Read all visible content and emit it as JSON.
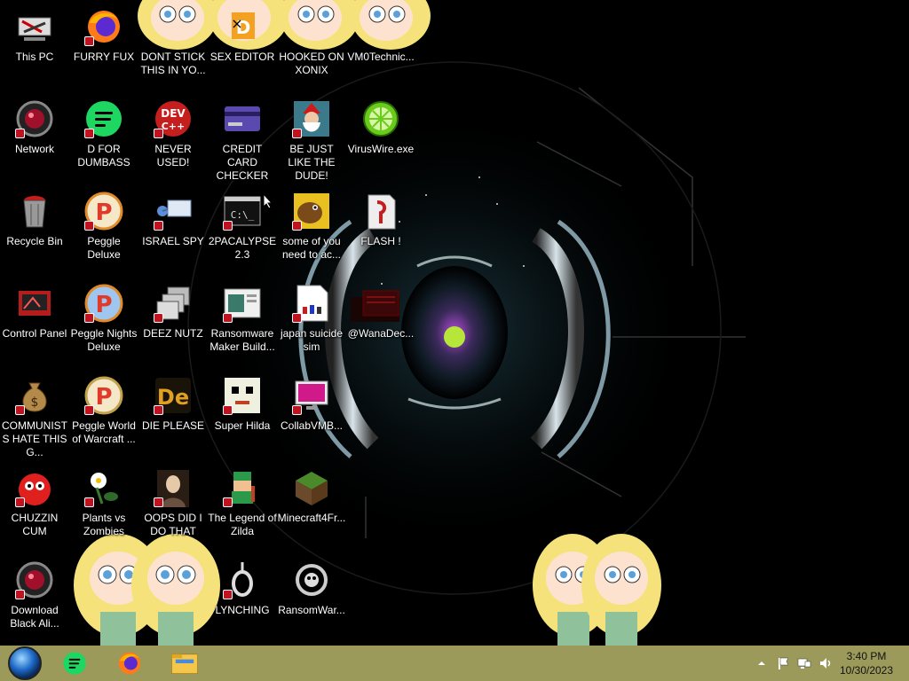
{
  "desktop": {
    "icons": [
      {
        "label": "This PC",
        "icon": "computer-icon"
      },
      {
        "label": "FURRY FUX",
        "icon": "firefox-icon"
      },
      {
        "label": "DONT STICK THIS IN YO...",
        "icon": "cartoon-girl-icon"
      },
      {
        "label": "SEX EDITOR",
        "icon": "editor-icon"
      },
      {
        "label": "HOOKED ON XONIX",
        "icon": "cartoon-girl-icon"
      },
      {
        "label": "VM0Technic...",
        "icon": "cartoon-girl-icon"
      },
      {
        "label": "Network",
        "icon": "network-icon"
      },
      {
        "label": "D FOR DUMBASS",
        "icon": "spotify-icon"
      },
      {
        "label": "NEVER USED!",
        "icon": "devcpp-icon"
      },
      {
        "label": "CREDIT CARD CHECKER",
        "icon": "credit-card-icon"
      },
      {
        "label": "BE JUST LIKE THE DUDE!",
        "icon": "santa-icon"
      },
      {
        "label": "VirusWire.exe",
        "icon": "lime-icon"
      },
      {
        "label": "Recycle Bin",
        "icon": "recycle-bin-icon"
      },
      {
        "label": "Peggle Deluxe",
        "icon": "peggle-icon"
      },
      {
        "label": "ISRAEL SPY",
        "icon": "network-spy-icon"
      },
      {
        "label": "2PACALYPSE 2.3",
        "icon": "terminal-icon"
      },
      {
        "label": "some of you need to ac...",
        "icon": "dog-icon"
      },
      {
        "label": "FLASH !",
        "icon": "flash-icon"
      },
      {
        "label": "Control Panel",
        "icon": "control-panel-icon"
      },
      {
        "label": "Peggle Nights Deluxe",
        "icon": "peggle-icon"
      },
      {
        "label": "DEEZ NUTZ",
        "icon": "stacked-windows-icon"
      },
      {
        "label": "Ransomware Maker Build...",
        "icon": "window-app-icon"
      },
      {
        "label": "japan suicide sim",
        "icon": "document-icon"
      },
      {
        "label": "@WanaDec...",
        "icon": "wannacry-icon"
      },
      {
        "label": "COMMUNISTS HATE THIS G...",
        "icon": "money-bag-icon"
      },
      {
        "label": "Peggle World of Warcraft ...",
        "icon": "peggle-icon"
      },
      {
        "label": "DIE PLEASE",
        "icon": "die-icon"
      },
      {
        "label": "Super Hilda",
        "icon": "pixel-dog-icon"
      },
      {
        "label": "CollabVMB...",
        "icon": "monitor-icon"
      },
      {
        "label": "CHUZZIN CUM",
        "icon": "chuzzle-icon"
      },
      {
        "label": "Plants vs Zombies",
        "icon": "flower-icon"
      },
      {
        "label": "OOPS DID I DO THAT",
        "icon": "portrait-icon"
      },
      {
        "label": "The Legend of Zilda",
        "icon": "pixel-hero-icon"
      },
      {
        "label": "Minecraft4Fr...",
        "icon": "grass-block-icon"
      },
      {
        "label": "Download Black Ali...",
        "icon": "network-icon"
      },
      {
        "label": "LYNCHING",
        "icon": "noose-icon"
      },
      {
        "label": "RansomWar...",
        "icon": "skull-icon"
      }
    ]
  },
  "taskbar": {
    "start_icon": "start-orb-icon",
    "pinned": [
      "spotify-icon",
      "firefox-icon",
      "file-explorer-icon"
    ],
    "tray_icons": [
      "show-hidden-icons-icon",
      "flag-icon",
      "network-tray-icon",
      "volume-icon"
    ],
    "clock": {
      "time": "3:40 PM",
      "date": "10/30/2023"
    },
    "color": "#9b9a5a"
  }
}
